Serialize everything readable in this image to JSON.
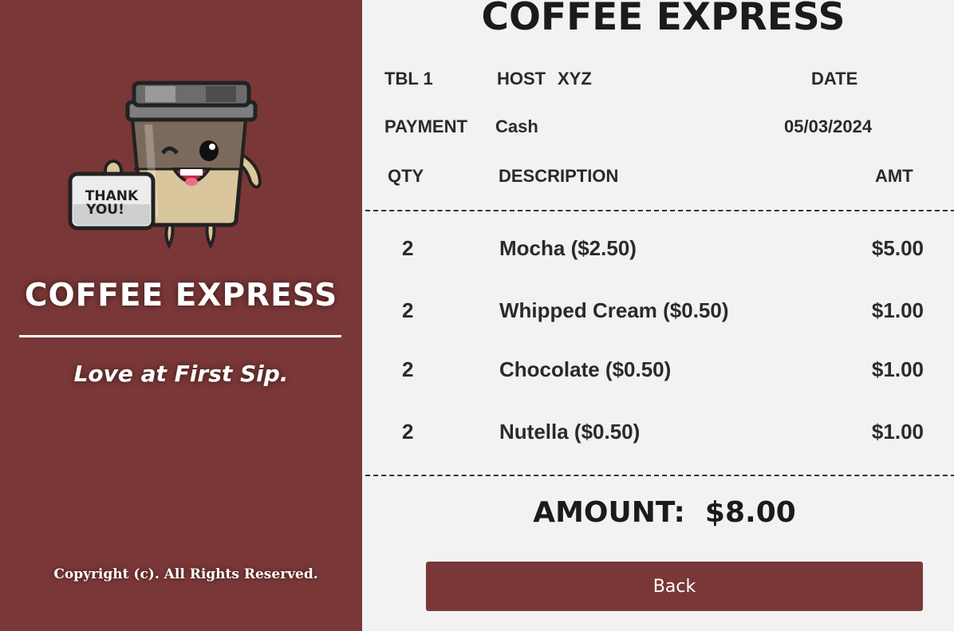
{
  "sidebar": {
    "brand": "COFFEE EXPRESS",
    "tagline": "Love at First Sip.",
    "copyright": "Copyright (c). All Rights Reserved.",
    "mascot_sign": "THANK YOU!",
    "mascot_sign_line1": "THANK",
    "mascot_sign_line2": "YOU!"
  },
  "receipt": {
    "title": "COFFEE EXPRESS",
    "table": "TBL 1",
    "host_label": "HOST",
    "host_value": "XYZ",
    "date_label": "DATE",
    "payment_label": "PAYMENT",
    "payment_value": "Cash",
    "date_value": "05/03/2024",
    "columns": {
      "qty": "QTY",
      "description": "DESCRIPTION",
      "amt": "AMT"
    },
    "items": [
      {
        "qty": "2",
        "description": "Mocha ($2.50)",
        "amt": "$5.00"
      },
      {
        "qty": "2",
        "description": "Whipped Cream ($0.50)",
        "amt": "$1.00"
      },
      {
        "qty": "2",
        "description": "Chocolate ($0.50)",
        "amt": "$1.00"
      },
      {
        "qty": "2",
        "description": "Nutella ($0.50)",
        "amt": "$1.00"
      }
    ],
    "amount_label": "AMOUNT:",
    "amount_value": "$8.00",
    "back_label": "Back"
  },
  "colors": {
    "accent": "#7a3737",
    "background": "#f2f2f2",
    "text": "#1e1e1e"
  },
  "icons": {
    "mascot": "coffee-cup-mascot-icon"
  }
}
